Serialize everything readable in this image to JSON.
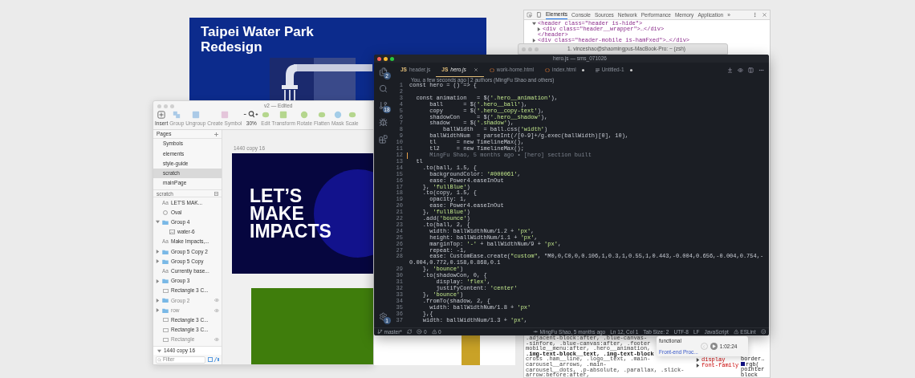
{
  "design_board": {
    "title": "Taipei Water Park Redesign"
  },
  "devtools": {
    "tabs": [
      {
        "label": "Elements",
        "selected": true
      },
      {
        "label": "Console",
        "selected": false
      },
      {
        "label": "Sources",
        "selected": false
      },
      {
        "label": "Network",
        "selected": false
      },
      {
        "label": "Performance",
        "selected": false
      },
      {
        "label": "Memory",
        "selected": false
      },
      {
        "label": "Application",
        "selected": false
      }
    ],
    "overflow": "»",
    "dom_tree": [
      {
        "open": "<header class=\"header is-hide\">",
        "expanded": true,
        "children": [
          {
            "open": "<div class=\"header__wrapper\">…</div>",
            "expanded": false
          }
        ],
        "close": "</header>"
      },
      {
        "open": "<div class=\"header-mobile is-hamFxed\">…</div>",
        "expanded": false
      }
    ],
    "css_lines": [
      ".adjacent-block:after, .blue-canvas-",
      "-sinfore, .blue-canvas:after, .footer",
      "mobile__menu:after, .hero__animation,",
      ".img-text-block__text, .img-text-block",
      "cross .ham__line, .logo__text, .main-carousel__arrows, .main-",
      "carousel__dots, .p-absolute, .parallax, .slick-arrow:before:after,"
    ],
    "style_props": [
      "display",
      "font-family"
    ],
    "style_values": [
      {
        "text": "border…",
        "swatch": false
      },
      {
        "text": "rgb(",
        "swatch": true
      },
      {
        "text": "pointer",
        "swatch": false
      },
      {
        "text": "block",
        "swatch": false
      }
    ]
  },
  "terminal": {
    "title": "1. vinceshao@shaomingpus-MacBook-Pro: ~ (zsh)"
  },
  "editor": {
    "title": "hero.js — sms_071026",
    "activity": [
      {
        "kind": "files",
        "badge": "2"
      },
      {
        "kind": "search"
      },
      {
        "kind": "git",
        "badge": "18"
      },
      {
        "kind": "debug"
      },
      {
        "kind": "extensions"
      }
    ],
    "settings_badge": "1",
    "tabs": [
      {
        "label": "header.js",
        "kind": "js",
        "icon_text": "JS",
        "selected": false,
        "dirty": false
      },
      {
        "label": "hero.js",
        "kind": "js",
        "icon_text": "JS",
        "selected": true,
        "dirty": false
      },
      {
        "label": "work-home.html",
        "kind": "html",
        "selected": false,
        "dirty": false
      },
      {
        "label": "index.html",
        "kind": "html",
        "selected": false,
        "dirty": true
      },
      {
        "label": "Untitled-1",
        "kind": "doc",
        "selected": false,
        "dirty": true
      }
    ],
    "blame_header": "You, a few seconds ago | 2 authors (MingFu Shao and others)",
    "lines": [
      {
        "number": "1",
        "kind": "code",
        "text": "const hero = () => {"
      },
      {
        "number": "2",
        "kind": "code"
      },
      {
        "number": "3",
        "kind": "code",
        "text": "  const animation   = $('.hero__animation'),"
      },
      {
        "number": "4",
        "kind": "code",
        "text": "      ball      = $('.hero__ball'),"
      },
      {
        "number": "5",
        "kind": "code",
        "text": "      copy      = $('.hero__copy-text'),"
      },
      {
        "number": "6",
        "kind": "code",
        "text": "      shadowCon     = $('.hero__shadow'),"
      },
      {
        "number": "7",
        "kind": "code",
        "text": "      shadow    = $('.shadow'),"
      },
      {
        "number": "8",
        "kind": "code",
        "text": "          ballWidth   = ball.css('width')"
      },
      {
        "number": "9",
        "kind": "code",
        "text": "      ballWidthNum  = parseInt(/[0-9]+/g.exec(ballWidth)[0], 10),"
      },
      {
        "number": "10",
        "kind": "code",
        "text": "      tl      = new TimelineMax(),"
      },
      {
        "number": "11",
        "kind": "code",
        "text": "      tl2     = new TimelineMax();"
      },
      {
        "number": "12",
        "kind": "blame",
        "text": "      MingFu Shao, 5 months ago • [hero] section built"
      },
      {
        "number": "13",
        "kind": "code",
        "text": "  tl"
      },
      {
        "number": "14",
        "kind": "code",
        "text": "    .to(ball, 1.5, {"
      },
      {
        "number": "15",
        "kind": "code",
        "text": "      backgroundColor: '#000061',"
      },
      {
        "number": "16",
        "kind": "code",
        "text": "      ease: Power4.easeInOut"
      },
      {
        "number": "17",
        "kind": "code",
        "text": "    }, 'fullBlue')"
      },
      {
        "number": "18",
        "kind": "code",
        "text": "    .to(copy, 1.5, {"
      },
      {
        "number": "19",
        "kind": "code",
        "text": "      opacity: 1,"
      },
      {
        "number": "20",
        "kind": "code",
        "text": "      ease: Power4.easeInOut"
      },
      {
        "number": "21",
        "kind": "code",
        "text": "    }, 'fullBlue')"
      },
      {
        "number": "22",
        "kind": "code",
        "text": "    .add('bounce')"
      },
      {
        "number": "23",
        "kind": "code",
        "text": "    .to(ball, 2, {"
      },
      {
        "number": "24",
        "kind": "code",
        "text": "      width: ballWidthNum/1.2 + 'px',"
      },
      {
        "number": "25",
        "kind": "code",
        "text": "      height: ballWidthNum/1.1 + 'px',"
      },
      {
        "number": "26",
        "kind": "code",
        "text": "      marginTop: '-' + ballWidthNum/9 + 'px',"
      },
      {
        "number": "27",
        "kind": "code",
        "text": "      repeat: -1,"
      },
      {
        "number": "28",
        "kind": "code",
        "text": "      ease: CustomEase.create(\"custom\", \"M0,0,C0,0,0.106,1,0.3,1,0.55,1,0.443,-0.004,0.656,-0.004,0.754,-0.004,0.772,0.158,0.868,0.1"
      },
      {
        "number": "29",
        "kind": "code",
        "text": "    }, 'bounce')"
      },
      {
        "number": "30",
        "kind": "code",
        "text": "    .to(shadowCon, 0, {"
      },
      {
        "number": "31",
        "kind": "code",
        "text": "        display: 'flex',"
      },
      {
        "number": "32",
        "kind": "code",
        "text": "        justifyContent: 'center'"
      },
      {
        "number": "33",
        "kind": "code",
        "text": "    }, 'bounce')"
      },
      {
        "number": "34",
        "kind": "code",
        "text": "    .fromTo(shadow, 2, {"
      },
      {
        "number": "35",
        "kind": "code",
        "text": "      width: ballWidthNum/1.8 + 'px'"
      },
      {
        "number": "36",
        "kind": "code",
        "text": "    },{"
      },
      {
        "number": "37",
        "kind": "code",
        "text": "    width: ballWidthNum/1.3 + 'px',"
      }
    ],
    "status_left": [
      {
        "kind": "branch",
        "text": "master*"
      },
      {
        "kind": "sync"
      },
      {
        "kind": "error",
        "text": "0"
      },
      {
        "kind": "warning",
        "text": "0"
      }
    ],
    "status_right": [
      {
        "kind": "commit",
        "text": "MingFu Shao, 5 months ago"
      },
      {
        "kind": "plain",
        "text": "Ln 12, Col 1"
      },
      {
        "kind": "plain",
        "text": "Tab Size: 2"
      },
      {
        "kind": "plain",
        "text": "UTF-8"
      },
      {
        "kind": "plain",
        "text": "LF"
      },
      {
        "kind": "plain",
        "text": "JavaScript"
      },
      {
        "kind": "warning",
        "text": "ESLint"
      },
      {
        "kind": "smiley"
      }
    ]
  },
  "sketch": {
    "title": "v2 — Edited",
    "toolbar": [
      {
        "label": "Insert",
        "kind": "plus",
        "disabled": false
      },
      {
        "label": "Group",
        "kind": "group",
        "disabled": true
      },
      {
        "label": "Ungroup",
        "kind": "ungroup",
        "disabled": true
      },
      {
        "label": "Create Symbol",
        "kind": "symbol",
        "disabled": true
      },
      {
        "label": "30%",
        "kind": "zoom",
        "disabled": false
      },
      {
        "label": "Edit",
        "kind": "edit",
        "disabled": true
      },
      {
        "label": "Transform",
        "kind": "transform",
        "disabled": true
      },
      {
        "label": "Rotate",
        "kind": "rotate",
        "disabled": true
      },
      {
        "label": "Flatten",
        "kind": "flatten",
        "disabled": true
      },
      {
        "label": "Mask",
        "kind": "mask",
        "disabled": true
      },
      {
        "label": "Scale",
        "kind": "scale",
        "disabled": true
      }
    ],
    "pages_label": "Pages",
    "pages": [
      {
        "label": "Symbols",
        "selected": false
      },
      {
        "label": "elements",
        "selected": false
      },
      {
        "label": "style-guide",
        "selected": false
      },
      {
        "label": "scratch",
        "selected": true
      },
      {
        "label": "mainPage",
        "selected": false
      }
    ],
    "layers_label": "scratch",
    "layers": [
      {
        "name": "LET’S MAK...",
        "kind": "text",
        "type_label": "Aa",
        "hidden": false
      },
      {
        "name": "Oval",
        "kind": "oval",
        "hidden": false
      },
      {
        "name": "Group 4",
        "kind": "group",
        "expanded": true,
        "hidden": false,
        "children": [
          {
            "name": "water-6",
            "kind": "image",
            "hidden": false
          }
        ]
      },
      {
        "name": "Make Impacts,...",
        "kind": "text",
        "type_label": "Aa",
        "hidden": false
      },
      {
        "name": "Group 5 Copy 2",
        "kind": "group",
        "expanded": false,
        "hidden": false
      },
      {
        "name": "Group 5 Copy",
        "kind": "group",
        "expanded": false,
        "hidden": false
      },
      {
        "name": "Currently base...",
        "kind": "text",
        "type_label": "Aa",
        "hidden": false
      },
      {
        "name": "Group 3",
        "kind": "group",
        "expanded": false,
        "hidden": false
      },
      {
        "name": "Rectangle 3 C...",
        "kind": "rect",
        "hidden": false
      },
      {
        "name": "Group 2",
        "kind": "group",
        "expanded": false,
        "hidden": true
      },
      {
        "name": "row",
        "kind": "group",
        "expanded": false,
        "hidden": true
      },
      {
        "name": "Rectangle 3 C...",
        "kind": "rect",
        "hidden": false
      },
      {
        "name": "Rectangle 3 C...",
        "kind": "rect",
        "hidden": false
      },
      {
        "name": "Rectangle",
        "kind": "rect",
        "hidden": true
      }
    ],
    "artboard_row": {
      "name": "1440 copy 16",
      "expanded": true
    },
    "filter": {
      "placeholder": "Filter"
    },
    "artboard_label": "1440 copy 16",
    "artboard_headline": "LET’S MAKE IMPACTS"
  },
  "media_popover": {
    "title": "functional",
    "subtitle": "Front-end Proc...",
    "time": "1:02:24"
  }
}
